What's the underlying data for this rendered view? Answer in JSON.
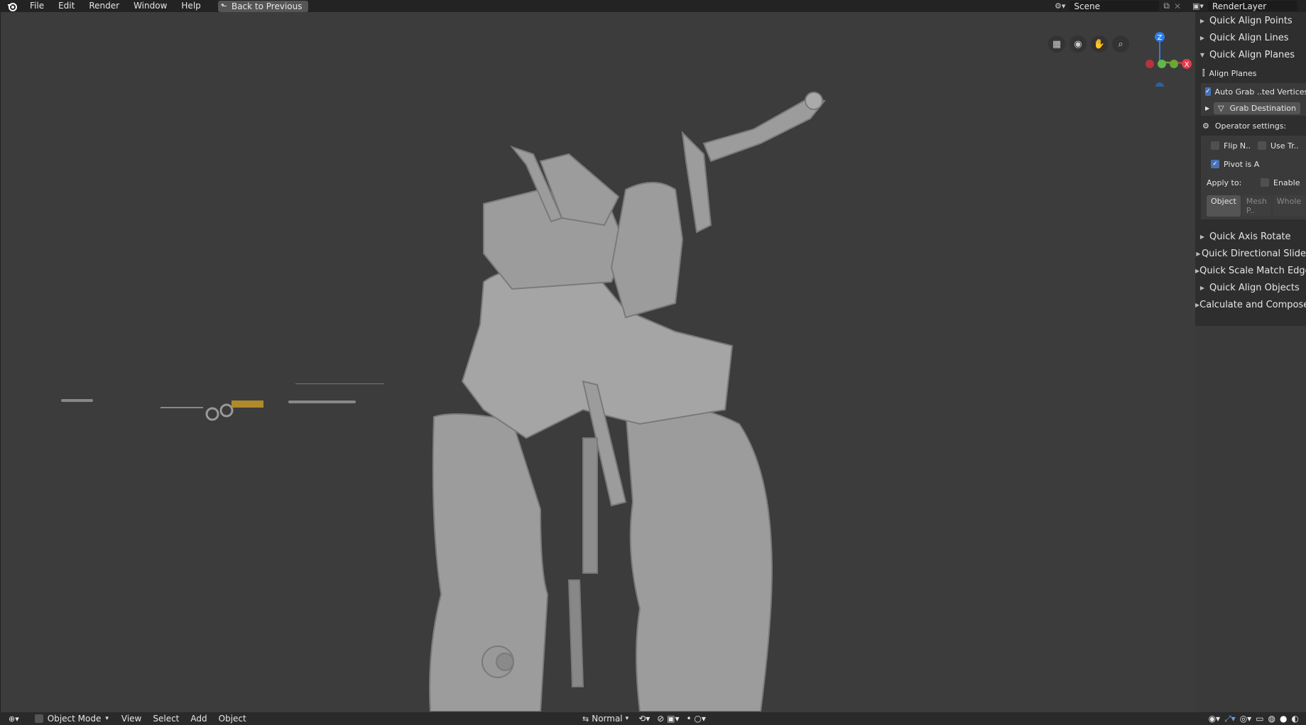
{
  "topbar": {
    "menus": [
      "File",
      "Edit",
      "Render",
      "Window",
      "Help"
    ],
    "back_button": "Back to Previous",
    "scene": "Scene",
    "render_layer": "RenderLayer"
  },
  "gizmo": {
    "z": "Z",
    "x": "X"
  },
  "sidebar": {
    "items_top": [
      "Quick Align Points",
      "Quick Align Lines",
      "Quick Align Planes"
    ],
    "align_planes": "Align Planes",
    "auto_grab": "Auto Grab ..ted Vertices",
    "grab_destination": "Grab Destination",
    "operator_settings": "Operator settings:",
    "flip_n": "Flip N..",
    "use_tr": "Use Tr..",
    "pivot_is_a": "Pivot is A",
    "apply_to": "Apply to:",
    "enable": "Enable",
    "apply_options": [
      "Object",
      "Mesh P..",
      "Whole"
    ],
    "items_bottom": [
      "Quick Axis Rotate",
      "Quick Directional Slide",
      "Quick Scale Match Edge",
      "Quick Align Objects",
      "Calculate and Compose"
    ]
  },
  "bottombar": {
    "mode": "Object Mode",
    "menus": [
      "View",
      "Select",
      "Add",
      "Object"
    ],
    "orientation": "Normal"
  }
}
